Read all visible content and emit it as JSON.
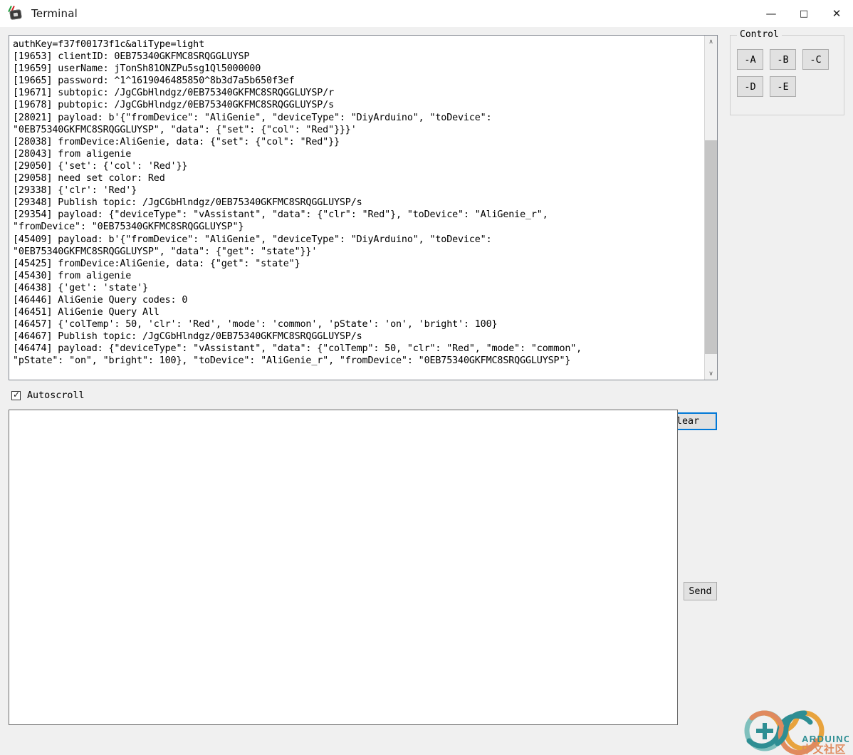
{
  "window": {
    "title": "Terminal",
    "app_icon": "arduino-board-icon",
    "buttons": {
      "minimize": "—",
      "maximize": "☐",
      "close": "✕"
    }
  },
  "log": {
    "name": "serial-monitor-output",
    "scrollbar": {
      "up_arrow": "∧",
      "down_arrow": "∨"
    },
    "lines": [
      "authKey=f37f00173f1c&aliType=light",
      "[19653] clientID: 0EB75340GKFMC8SRQGGLUYSP",
      "[19659] userName: jTonSh81ONZPu5sg1Ql5000000",
      "[19665] password: ^1^1619046485850^8b3d7a5b650f3ef",
      "[19671] subtopic: /JgCGbHlndgz/0EB75340GKFMC8SRQGGLUYSP/r",
      "[19678] pubtopic: /JgCGbHlndgz/0EB75340GKFMC8SRQGGLUYSP/s",
      "[28021] payload: b'{\"fromDevice\": \"AliGenie\", \"deviceType\": \"DiyArduino\", \"toDevice\":",
      "\"0EB75340GKFMC8SRQGGLUYSP\", \"data\": {\"set\": {\"col\": \"Red\"}}}'",
      "[28038] fromDevice:AliGenie, data: {\"set\": {\"col\": \"Red\"}}",
      "[28043] from aligenie",
      "[29050] {'set': {'col': 'Red'}}",
      "[29058] need set color: Red",
      "[29338] {'clr': 'Red'}",
      "[29348] Publish topic: /JgCGbHlndgz/0EB75340GKFMC8SRQGGLUYSP/s",
      "[29354] payload: {\"deviceType\": \"vAssistant\", \"data\": {\"clr\": \"Red\"}, \"toDevice\": \"AliGenie_r\",",
      "\"fromDevice\": \"0EB75340GKFMC8SRQGGLUYSP\"}",
      "[45409] payload: b'{\"fromDevice\": \"AliGenie\", \"deviceType\": \"DiyArduino\", \"toDevice\":",
      "\"0EB75340GKFMC8SRQGGLUYSP\", \"data\": {\"get\": \"state\"}}'",
      "[45425] fromDevice:AliGenie, data: {\"get\": \"state\"}",
      "[45430] from aligenie",
      "[46438] {'get': 'state'}",
      "[46446] AliGenie Query codes: 0",
      "[46451] AliGenie Query All",
      "[46457] {'colTemp': 50, 'clr': 'Red', 'mode': 'common', 'pState': 'on', 'bright': 100}",
      "[46467] Publish topic: /JgCGbHlndgz/0EB75340GKFMC8SRQGGLUYSP/s",
      "[46474] payload: {\"deviceType\": \"vAssistant\", \"data\": {\"colTemp\": 50, \"clr\": \"Red\", \"mode\": \"common\",",
      "\"pState\": \"on\", \"bright\": 100}, \"toDevice\": \"AliGenie_r\", \"fromDevice\": \"0EB75340GKFMC8SRQGGLUYSP\"}"
    ]
  },
  "control": {
    "legend": "Control",
    "buttons_row1": [
      {
        "label": "-A",
        "name": "control-button-a"
      },
      {
        "label": "-B",
        "name": "control-button-b"
      },
      {
        "label": "-C",
        "name": "control-button-c"
      }
    ],
    "buttons_row2": [
      {
        "label": "-D",
        "name": "control-button-d"
      },
      {
        "label": "-E",
        "name": "control-button-e"
      }
    ]
  },
  "toolbar": {
    "autoscroll_label": "Autoscroll",
    "autoscroll_checked": true,
    "autoscroll_tick": "✓",
    "clear_label": "Clear"
  },
  "send": {
    "value": "",
    "placeholder": "",
    "button_label": "Send"
  },
  "logo": {
    "brand": "ARDUINO",
    "community": "中文社区",
    "plus": "+",
    "colors": {
      "teal": "#2e8e93",
      "orange": "#e8a33d",
      "light_teal": "#7fc0bd",
      "salmon": "#e08a5e"
    }
  },
  "colors": {
    "accent": "#0078d7",
    "window_bg": "#f0f0f0",
    "field_bg": "#ffffff",
    "button_bg": "#e1e1e1"
  }
}
